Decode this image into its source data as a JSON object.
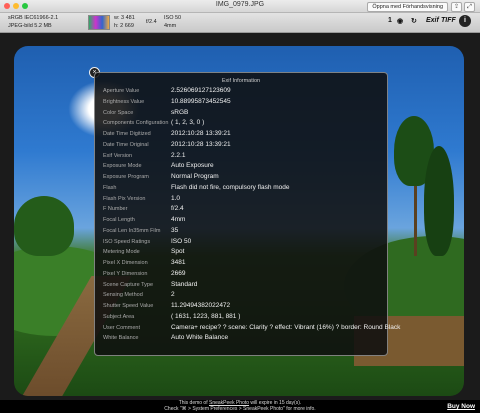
{
  "window": {
    "title": "IMG_0979.JPG",
    "open_with_label": "Öppna med Förhandsvisning",
    "share_icon": "share-icon",
    "fullscreen_icon": "fullscreen-icon"
  },
  "toolbar": {
    "color_profile": "sRGB IEC61966-2.1",
    "file_info": "JPEG-bild 5.2 MB",
    "width": "w: 3 481",
    "height": "h: 2 669",
    "aperture": "f/2.4",
    "iso": "ISO 50",
    "focal": "4mm",
    "flash_value": "1",
    "exif_label": "Exif",
    "tiff_label": "TIFF",
    "info_label": "i"
  },
  "exif": {
    "title": "Exif Information",
    "rows": [
      {
        "label": "Aperture Value",
        "value": "2.526069127123609"
      },
      {
        "label": "Brightness Value",
        "value": "10.88995873452545"
      },
      {
        "label": "Color Space",
        "value": "sRGB"
      },
      {
        "label": "Components Configuration",
        "value": "( 1, 2, 3, 0 )"
      },
      {
        "label": "Date Time Digitized",
        "value": "2012:10:28 13:39:21"
      },
      {
        "label": "Date Time Original",
        "value": "2012:10:28 13:39:21"
      },
      {
        "label": "Exif Version",
        "value": "2.2.1"
      },
      {
        "label": "Exposure Mode",
        "value": "Auto Exposure"
      },
      {
        "label": "Exposure Program",
        "value": "Normal Program"
      },
      {
        "label": "Flash",
        "value": "Flash did not fire, compulsory flash mode"
      },
      {
        "label": "Flash Pix Version",
        "value": "1.0"
      },
      {
        "label": "F Number",
        "value": "f/2.4"
      },
      {
        "label": "Focal Length",
        "value": "4mm"
      },
      {
        "label": "Focal Len In35mm Film",
        "value": "35"
      },
      {
        "label": "ISO Speed Ratings",
        "value": "ISO 50"
      },
      {
        "label": "Metering Mode",
        "value": "Spot"
      },
      {
        "label": "Pixel X Dimension",
        "value": "3481"
      },
      {
        "label": "Pixel Y Dimension",
        "value": "2669"
      },
      {
        "label": "Scene Capture Type",
        "value": "Standard"
      },
      {
        "label": "Sensing Method",
        "value": "2"
      },
      {
        "label": "Shutter Speed Value",
        "value": "11.29494382022472"
      },
      {
        "label": "Subject Area",
        "value": "( 1631, 1223, 881, 881 )"
      },
      {
        "label": "User Comment",
        "value": "Camera+ recipe? ? scene: Clarity ? effect: Vibrant (16%) ? border: Round Black"
      },
      {
        "label": "White Balance",
        "value": "Auto White Balance"
      }
    ]
  },
  "footer": {
    "demo_prefix": "This demo of",
    "demo_app": "SneakPeek Photo",
    "demo_suffix": "will expire in 15 day(s).",
    "demo_line2": "Check \"⌘ > System Preferences > SneakPeek Photo\" for more info.",
    "buy_now": "Buy Now"
  }
}
